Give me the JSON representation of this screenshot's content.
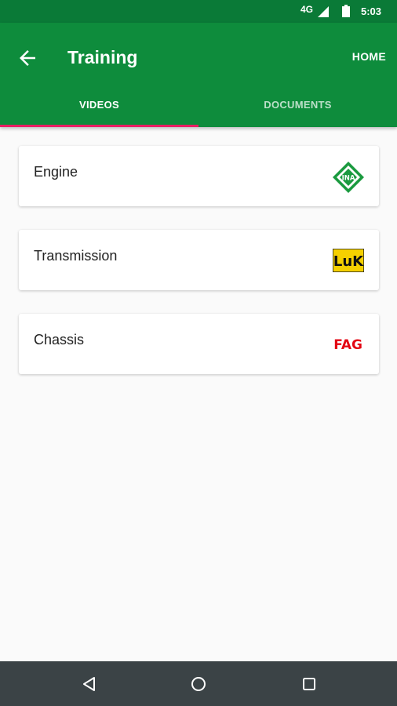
{
  "status_bar": {
    "network": "4G",
    "time": "5:03"
  },
  "header": {
    "title": "Training",
    "home_label": "HOME"
  },
  "tabs": [
    {
      "label": "VIDEOS",
      "selected": true
    },
    {
      "label": "DOCUMENTS",
      "selected": false
    }
  ],
  "categories": [
    {
      "label": "Engine",
      "brand": "INA"
    },
    {
      "label": "Transmission",
      "brand": "LuK"
    },
    {
      "label": "Chassis",
      "brand": "FAG"
    }
  ],
  "colors": {
    "status_bar": "#0a7a37",
    "app_bar": "#0e8c3c",
    "tab_indicator": "#e91e63",
    "background": "#fafafa",
    "nav_bar": "#3b4346",
    "ina_green": "#1a9a3f",
    "luk_yellow": "#f5d000",
    "fag_red": "#e30613"
  }
}
